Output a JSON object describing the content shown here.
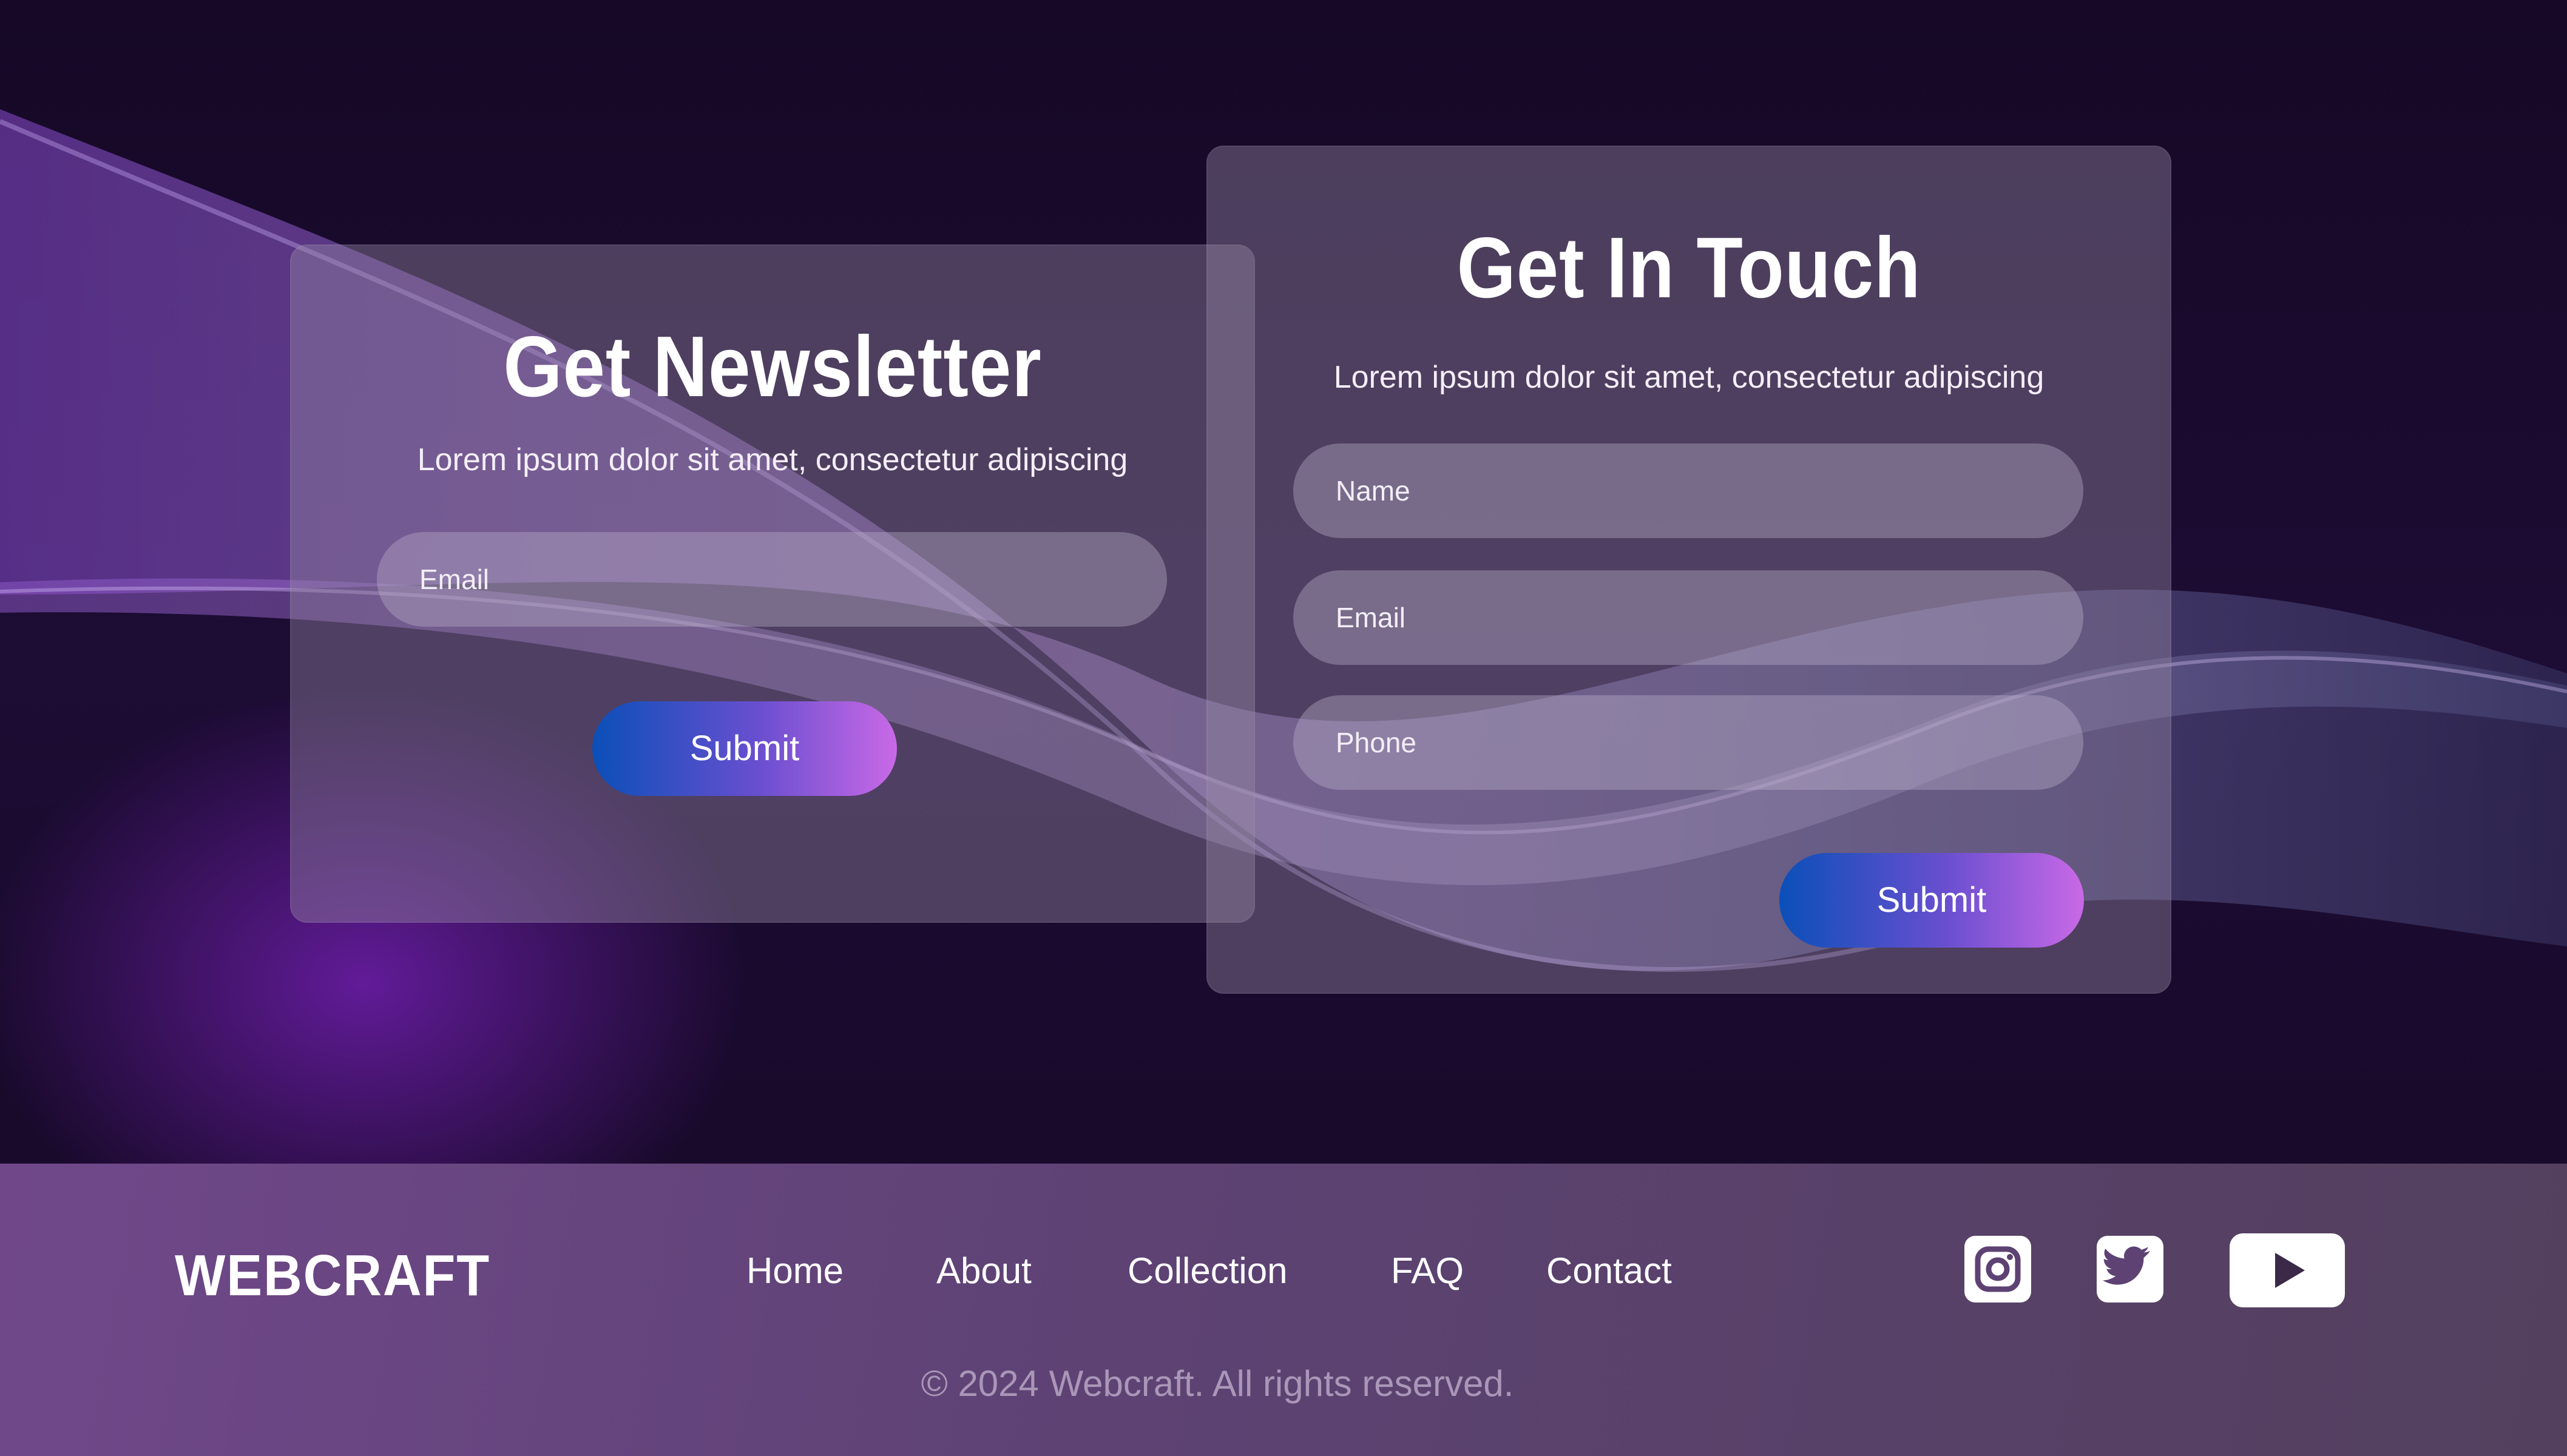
{
  "newsletter": {
    "title": "Get Newsletter",
    "subtitle": "Lorem ipsum dolor sit amet, consectetur adipiscing",
    "email_placeholder": "Email",
    "submit_label": "Submit"
  },
  "contact": {
    "title": "Get In Touch",
    "subtitle": "Lorem ipsum dolor sit amet, consectetur adipiscing",
    "name_placeholder": "Name",
    "email_placeholder": "Email",
    "phone_placeholder": "Phone",
    "submit_label": "Submit"
  },
  "footer": {
    "logo": "WEBCRAFT",
    "nav": [
      "Home",
      "About",
      "Collection",
      "FAQ",
      "Contact"
    ],
    "social": [
      "instagram-icon",
      "twitter-icon",
      "youtube-icon"
    ],
    "copyright": "© 2024 Webcraft. All rights reserved."
  },
  "colors": {
    "background": "#170a26",
    "button_start": "#0b4fb8",
    "button_end": "#c969e6",
    "footer": "#5d4273"
  }
}
